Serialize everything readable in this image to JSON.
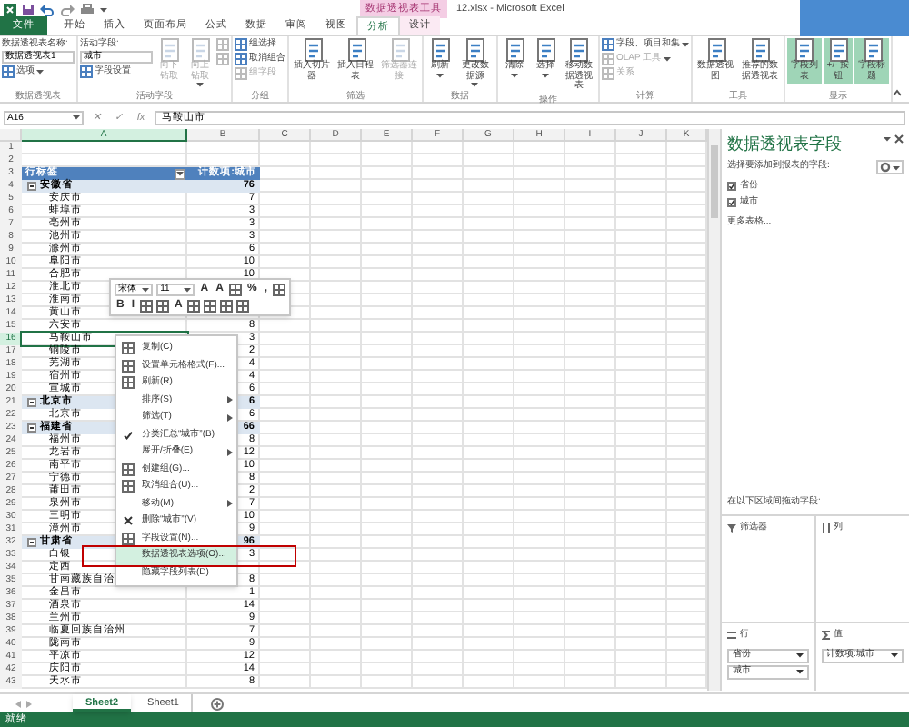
{
  "window": {
    "title": "12.xlsx - Microsoft Excel",
    "context_tab_group": "数据透视表工具"
  },
  "tabs": [
    {
      "label": "文件",
      "kind": "file",
      "selected": false
    },
    {
      "label": "开始",
      "kind": "tab",
      "selected": false
    },
    {
      "label": "插入",
      "kind": "tab",
      "selected": false
    },
    {
      "label": "页面布局",
      "kind": "tab",
      "selected": false
    },
    {
      "label": "公式",
      "kind": "tab",
      "selected": false
    },
    {
      "label": "数据",
      "kind": "tab",
      "selected": false
    },
    {
      "label": "审阅",
      "kind": "tab",
      "selected": false
    },
    {
      "label": "视图",
      "kind": "tab",
      "selected": false
    },
    {
      "label": "分析",
      "kind": "context",
      "selected": true
    },
    {
      "label": "设计",
      "kind": "context",
      "selected": false
    }
  ],
  "ribbon": {
    "groups": [
      {
        "name": "数据透视表",
        "columns": [
          [
            {
              "kind": "label",
              "text": "数据透视表名称:"
            },
            {
              "kind": "field",
              "value": "数据透视表1"
            },
            {
              "kind": "small",
              "label": "选项",
              "dropdown": true,
              "disabled": false
            }
          ]
        ]
      },
      {
        "name": "活动字段",
        "columns": [
          [
            {
              "kind": "label",
              "text": "活动字段:"
            },
            {
              "kind": "field",
              "value": "城市"
            },
            {
              "kind": "small",
              "label": "字段设置",
              "dropdown": false,
              "disabled": false
            }
          ],
          [
            {
              "kind": "large",
              "label": "向下钻取",
              "dropdown": false,
              "disabled": true,
              "on": false
            }
          ],
          [
            {
              "kind": "large",
              "label": "向上钻取",
              "dropdown": true,
              "disabled": true,
              "on": false
            }
          ],
          [
            {
              "kind": "icon",
              "disabled": true
            },
            {
              "kind": "icon",
              "disabled": true
            }
          ]
        ]
      },
      {
        "name": "分组",
        "columns": [
          [
            {
              "kind": "small",
              "label": "组选择",
              "dropdown": false,
              "disabled": false
            },
            {
              "kind": "small",
              "label": "取消组合",
              "dropdown": false,
              "disabled": false
            },
            {
              "kind": "small",
              "label": "组字段",
              "dropdown": false,
              "disabled": true
            }
          ]
        ]
      },
      {
        "name": "筛选",
        "columns": [
          [
            {
              "kind": "large",
              "label": "插入切片器",
              "dropdown": false,
              "disabled": false,
              "on": false
            }
          ],
          [
            {
              "kind": "large",
              "label": "插入日程表",
              "dropdown": false,
              "disabled": false,
              "on": false
            }
          ],
          [
            {
              "kind": "large",
              "label": "筛选器连接",
              "dropdown": false,
              "disabled": true,
              "on": false
            }
          ]
        ]
      },
      {
        "name": "数据",
        "columns": [
          [
            {
              "kind": "large",
              "label": "刷新",
              "dropdown": true,
              "disabled": false,
              "on": false
            }
          ],
          [
            {
              "kind": "large",
              "label": "更改数据源",
              "dropdown": true,
              "disabled": false,
              "on": false
            }
          ]
        ]
      },
      {
        "name": "操作",
        "columns": [
          [
            {
              "kind": "large",
              "label": "清除",
              "dropdown": true,
              "disabled": false,
              "on": false
            }
          ],
          [
            {
              "kind": "large",
              "label": "选择",
              "dropdown": true,
              "disabled": false,
              "on": false
            }
          ],
          [
            {
              "kind": "large",
              "label": "移动数据透视表",
              "dropdown": false,
              "disabled": false,
              "on": false
            }
          ]
        ]
      },
      {
        "name": "计算",
        "columns": [
          [
            {
              "kind": "small",
              "label": "字段、项目和集",
              "dropdown": true,
              "disabled": false
            },
            {
              "kind": "small",
              "label": "OLAP 工具",
              "dropdown": true,
              "disabled": true
            },
            {
              "kind": "small",
              "label": "关系",
              "dropdown": false,
              "disabled": true
            }
          ]
        ]
      },
      {
        "name": "工具",
        "columns": [
          [
            {
              "kind": "large",
              "label": "数据透视图",
              "dropdown": false,
              "disabled": false,
              "on": false
            }
          ],
          [
            {
              "kind": "large",
              "label": "推荐的数据透视表",
              "dropdown": false,
              "disabled": false,
              "on": false
            }
          ]
        ]
      },
      {
        "name": "显示",
        "columns": [
          [
            {
              "kind": "large",
              "label": "字段列表",
              "dropdown": false,
              "disabled": false,
              "on": true
            }
          ],
          [
            {
              "kind": "large",
              "label": "+/- 按钮",
              "dropdown": false,
              "disabled": false,
              "on": true
            }
          ],
          [
            {
              "kind": "large",
              "label": "字段标题",
              "dropdown": false,
              "disabled": false,
              "on": true
            }
          ]
        ]
      }
    ]
  },
  "formula_bar": {
    "cell": "A16",
    "buttons": [
      "✕",
      "✓",
      "fx"
    ],
    "value": "马鞍山市"
  },
  "columns": [
    {
      "label": "A",
      "selected": true
    },
    {
      "label": "B",
      "selected": false
    },
    {
      "label": "C",
      "selected": false
    },
    {
      "label": "D",
      "selected": false
    },
    {
      "label": "E",
      "selected": false
    },
    {
      "label": "F",
      "selected": false
    },
    {
      "label": "G",
      "selected": false
    },
    {
      "label": "H",
      "selected": false
    },
    {
      "label": "I",
      "selected": false
    },
    {
      "label": "J",
      "selected": false
    },
    {
      "label": "K",
      "selected": false
    }
  ],
  "row_numbers": [
    "1",
    "2",
    "3",
    "4",
    "5",
    "6",
    "7",
    "8",
    "9",
    "10",
    "11",
    "12",
    "13",
    "14",
    "15",
    "16",
    "17",
    "18",
    "19",
    "20",
    "21",
    "22",
    "23",
    "24",
    "25",
    "26",
    "27",
    "28",
    "29",
    "30",
    "31",
    "32",
    "33",
    "34",
    "35",
    "36",
    "37",
    "38",
    "39",
    "40",
    "41",
    "42",
    "43"
  ],
  "pivot": {
    "header": {
      "row_label": "行标签",
      "value_label": "计数项:城市"
    },
    "rows": [
      {
        "kind": "group",
        "label": "安徽省",
        "value": "76",
        "expanded": true,
        "selected": false
      },
      {
        "kind": "item",
        "label": "安庆市",
        "value": "7",
        "selected": false
      },
      {
        "kind": "item",
        "label": "蚌埠市",
        "value": "3",
        "selected": false
      },
      {
        "kind": "item",
        "label": "亳州市",
        "value": "3",
        "selected": false
      },
      {
        "kind": "item",
        "label": "池州市",
        "value": "3",
        "selected": false
      },
      {
        "kind": "item",
        "label": "滁州市",
        "value": "6",
        "selected": false
      },
      {
        "kind": "item",
        "label": "阜阳市",
        "value": "10",
        "selected": false
      },
      {
        "kind": "item",
        "label": "合肥市",
        "value": "10",
        "selected": false
      },
      {
        "kind": "item",
        "label": "淮北市",
        "selected": false
      },
      {
        "kind": "item",
        "label": "淮南市",
        "selected": false
      },
      {
        "kind": "item",
        "label": "黄山市",
        "selected": false
      },
      {
        "kind": "item",
        "label": "六安市",
        "value": "8",
        "selected": false
      },
      {
        "kind": "item",
        "label": "马鞍山市",
        "value": "3",
        "selected": true
      },
      {
        "kind": "item",
        "label": "铜陵市",
        "value": "2",
        "selected": false
      },
      {
        "kind": "item",
        "label": "芜湖市",
        "value": "4",
        "selected": false
      },
      {
        "kind": "item",
        "label": "宿州市",
        "value": "4",
        "selected": false
      },
      {
        "kind": "item",
        "label": "宣城市",
        "value": "6",
        "selected": false
      },
      {
        "kind": "group",
        "label": "北京市",
        "value": "6",
        "expanded": true,
        "selected": false
      },
      {
        "kind": "item",
        "label": "北京市",
        "value": "6",
        "selected": false
      },
      {
        "kind": "group",
        "label": "福建省",
        "value": "66",
        "expanded": true,
        "selected": false
      },
      {
        "kind": "item",
        "label": "福州市",
        "value": "8",
        "selected": false
      },
      {
        "kind": "item",
        "label": "龙岩市",
        "value": "12",
        "selected": false
      },
      {
        "kind": "item",
        "label": "南平市",
        "value": "10",
        "selected": false
      },
      {
        "kind": "item",
        "label": "宁德市",
        "value": "8",
        "selected": false
      },
      {
        "kind": "item",
        "label": "莆田市",
        "value": "2",
        "selected": false
      },
      {
        "kind": "item",
        "label": "泉州市",
        "value": "7",
        "selected": false
      },
      {
        "kind": "item",
        "label": "三明市",
        "value": "10",
        "selected": false
      },
      {
        "kind": "item",
        "label": "漳州市",
        "value": "9",
        "selected": false
      },
      {
        "kind": "group",
        "label": "甘肃省",
        "value": "96",
        "expanded": true,
        "selected": false
      },
      {
        "kind": "item",
        "label": "白银",
        "value": "3",
        "selected": false
      },
      {
        "kind": "item",
        "label": "定西",
        "selected": false
      },
      {
        "kind": "item",
        "label": "甘南藏族自治",
        "value": "8",
        "selected": false
      },
      {
        "kind": "item",
        "label": "金昌市",
        "value": "1",
        "selected": false
      },
      {
        "kind": "item",
        "label": "酒泉市",
        "value": "14",
        "selected": false
      },
      {
        "kind": "item",
        "label": "兰州市",
        "value": "9",
        "selected": false
      },
      {
        "kind": "item",
        "label": "临夏回族自治州",
        "value": "7",
        "selected": false
      },
      {
        "kind": "item",
        "label": "陇南市",
        "value": "9",
        "selected": false
      },
      {
        "kind": "item",
        "label": "平凉市",
        "value": "12",
        "selected": false
      },
      {
        "kind": "item",
        "label": "庆阳市",
        "value": "14",
        "selected": false
      },
      {
        "kind": "item",
        "label": "天水市",
        "value": "8",
        "selected": false
      }
    ]
  },
  "mini_toolbar": {
    "font": "宋体",
    "size": "11",
    "upper_tools": [
      {
        "kind": "glyph",
        "text": "A"
      },
      {
        "kind": "glyph",
        "text": "A"
      },
      {
        "kind": "icon"
      },
      {
        "kind": "glyph",
        "text": "%"
      },
      {
        "kind": "glyph",
        "text": ","
      },
      {
        "kind": "icon"
      }
    ],
    "lower_tools": [
      {
        "kind": "glyph",
        "text": "B"
      },
      {
        "kind": "glyph",
        "text": "I"
      },
      {
        "kind": "icon"
      },
      {
        "kind": "icon"
      },
      {
        "kind": "glyph",
        "text": "A"
      },
      {
        "kind": "icon"
      },
      {
        "kind": "icon"
      },
      {
        "kind": "icon"
      },
      {
        "kind": "icon"
      }
    ]
  },
  "context_menu": {
    "items": [
      {
        "kind": "icon",
        "label": "复制(C)",
        "submenu": false,
        "checked": false,
        "selected": false
      },
      {
        "kind": "icon",
        "label": "设置单元格格式(F)...",
        "submenu": false,
        "checked": false,
        "selected": false
      },
      {
        "kind": "icon",
        "label": "刷新(R)",
        "submenu": false,
        "checked": false,
        "selected": false
      },
      {
        "kind": "plain",
        "label": "排序(S)",
        "submenu": true,
        "checked": false,
        "selected": false
      },
      {
        "kind": "plain",
        "label": "筛选(T)",
        "submenu": true,
        "checked": false,
        "selected": false
      },
      {
        "kind": "plain",
        "label": "分类汇总“城市”(B)",
        "submenu": false,
        "checked": true,
        "selected": false
      },
      {
        "kind": "plain",
        "label": "展开/折叠(E)",
        "submenu": true,
        "checked": false,
        "selected": false
      },
      {
        "kind": "icon",
        "label": "创建组(G)...",
        "submenu": false,
        "checked": false,
        "selected": false
      },
      {
        "kind": "icon",
        "label": "取消组合(U)...",
        "submenu": false,
        "checked": false,
        "selected": false
      },
      {
        "kind": "plain",
        "label": "移动(M)",
        "submenu": true,
        "checked": false,
        "selected": false
      },
      {
        "kind": "delete",
        "label": "删除“城市”(V)",
        "submenu": false,
        "checked": false,
        "selected": false
      },
      {
        "kind": "icon",
        "label": "字段设置(N)...",
        "submenu": false,
        "checked": false,
        "selected": false
      },
      {
        "kind": "plain",
        "label": "数据透视表选项(O)...",
        "submenu": false,
        "checked": false,
        "selected": true
      },
      {
        "kind": "plain",
        "label": "隐藏字段列表(D)",
        "submenu": false,
        "checked": false,
        "selected": false
      }
    ]
  },
  "field_pane": {
    "title": "数据透视表字段",
    "prompt": "选择要添加到报表的字段:",
    "fields": [
      {
        "label": "省份",
        "checked": true
      },
      {
        "label": "城市",
        "checked": true
      }
    ],
    "more_tables": "更多表格...",
    "drag_prompt": "在以下区域间拖动字段:",
    "areas": [
      {
        "kind": "filter",
        "label": "筛选器"
      },
      {
        "kind": "columns",
        "label": "列"
      },
      {
        "kind": "rows",
        "label": "行",
        "fields": [
          "省份",
          "城市"
        ]
      },
      {
        "kind": "values",
        "label": "值",
        "fields": [
          "计数项:城市"
        ]
      }
    ]
  },
  "sheet_tabs": [
    {
      "label": "Sheet2",
      "selected": true
    },
    {
      "label": "Sheet1",
      "selected": false
    }
  ],
  "status_bar": {
    "text": "就绪"
  }
}
